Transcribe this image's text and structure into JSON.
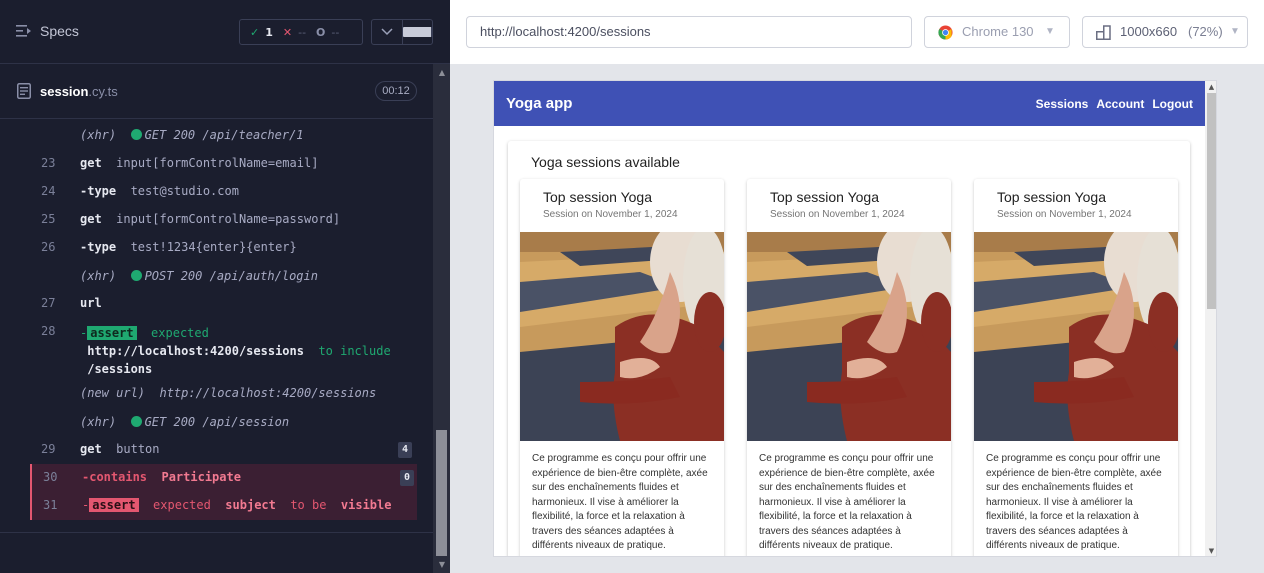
{
  "specs": {
    "title": "Specs"
  },
  "stats": {
    "pass_icon": "✓",
    "passed": "1",
    "fail_icon": "✕",
    "failed": "--",
    "pending_icon": "O",
    "pending": "--"
  },
  "file": {
    "name": "session",
    "ext": ".cy.ts",
    "time": "00:12"
  },
  "commands": [
    {
      "num": "",
      "type": "xhr",
      "prefix": "(xhr)",
      "method": "GET 200",
      "path": "/api/teacher/1"
    },
    {
      "num": "23",
      "cmd": "get",
      "arg": "input[formControlName=email]"
    },
    {
      "num": "24",
      "cmd": "-type",
      "arg": "test@studio.com"
    },
    {
      "num": "25",
      "cmd": "get",
      "arg": "input[formControlName=password]"
    },
    {
      "num": "26",
      "cmd": "-type",
      "arg": "test!1234{enter}{enter}"
    },
    {
      "num": "",
      "type": "xhr",
      "prefix": "(xhr)",
      "method": "POST 200",
      "path": "/api/auth/login"
    },
    {
      "num": "27",
      "cmd": "url",
      "arg": ""
    },
    {
      "num": "28",
      "cmd": "-",
      "badge": "assert",
      "expected": "expected",
      "url": "http://localhost:4200/sessions",
      "to_include": "to include",
      "value": "/sessions"
    },
    {
      "num": "",
      "type": "newurl",
      "prefix": "(new url)",
      "path": "http://localhost:4200/sessions"
    },
    {
      "num": "",
      "type": "xhr",
      "prefix": "(xhr)",
      "method": "GET 200",
      "path": "/api/session"
    },
    {
      "num": "29",
      "cmd": "get",
      "arg": "button",
      "count": "4"
    },
    {
      "num": "30",
      "cmd": "-contains",
      "arg": "Participate",
      "count": "0"
    },
    {
      "num": "31",
      "cmd": "-",
      "badge": "assert",
      "expected": "expected",
      "subject": "subject",
      "to_be": "to be",
      "visible": "visible"
    }
  ],
  "browser": {
    "url": "http://localhost:4200/sessions",
    "name": "Chrome 130",
    "viewport": "1000x660",
    "zoom": "(72%)"
  },
  "app": {
    "title": "Yoga app",
    "nav": [
      "Sessions",
      "Account",
      "Logout"
    ],
    "heading": "Yoga sessions available",
    "sessions": [
      {
        "name": "Top session Yoga",
        "date": "Session on November 1, 2024",
        "desc": "Ce programme es conçu pour offrir une expérience de bien-être complète, axée sur des enchaînements fluides et harmonieux. Il vise à améliorer la flexibilité, la force et la relaxation à travers des séances adaptées à différents niveaux de pratique."
      },
      {
        "name": "Top session Yoga",
        "date": "Session on November 1, 2024",
        "desc": "Ce programme es conçu pour offrir une expérience de bien-être complète, axée sur des enchaînements fluides et harmonieux. Il vise à améliorer la flexibilité, la force et la relaxation à travers des séances adaptées à différents niveaux de pratique."
      },
      {
        "name": "Top session Yoga",
        "date": "Session on November 1, 2024",
        "desc": "Ce programme es conçu pour offrir une expérience de bien-être complète, axée sur des enchaînements fluides et harmonieux. Il vise à améliorer la flexibilité, la force et la relaxation à travers des séances adaptées à différents niveaux de pratique."
      }
    ]
  },
  "icons": {
    "specs": "list-icon",
    "file": "document-icon",
    "browser": "chrome-icon",
    "viewport": "viewport-icon",
    "chevron": "chevron-down-icon",
    "stop": "stop-icon"
  },
  "colors": {
    "panel_bg": "#1b1e2e",
    "pass": "#1fa971",
    "fail": "#e45770",
    "toolbar": "#3f51b5"
  }
}
